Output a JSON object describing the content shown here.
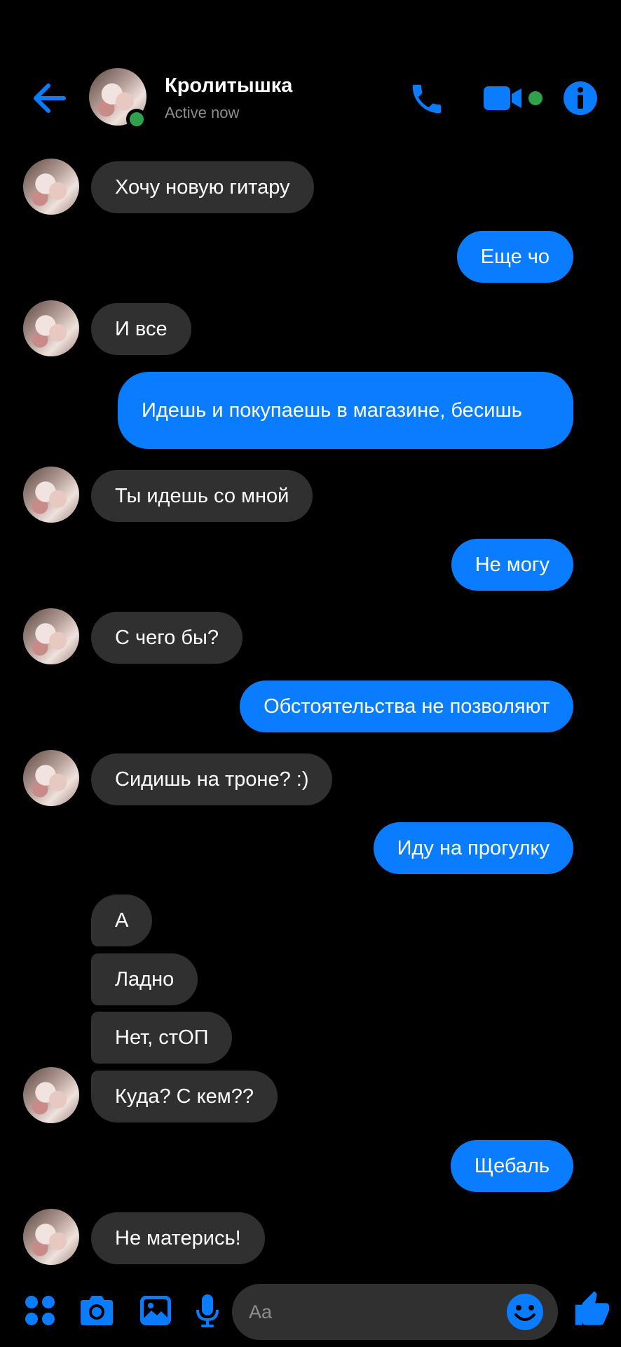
{
  "header": {
    "contact_name": "Кролитышка",
    "status": "Active now"
  },
  "colors": {
    "accent": "#0a7cff",
    "incoming_bubble": "#303030",
    "online": "#31a24c",
    "background": "#000000"
  },
  "icons": {
    "back": "arrow-left-icon",
    "call": "phone-icon",
    "video": "video-camera-icon",
    "info": "info-icon",
    "menu": "four-dots-icon",
    "camera": "camera-icon",
    "gallery": "image-icon",
    "mic": "microphone-icon",
    "emoji": "smiley-icon",
    "like": "thumbs-up-icon"
  },
  "messages": [
    {
      "from": "them",
      "text": "Хочу новую гитару"
    },
    {
      "from": "me",
      "text": "Еще чо"
    },
    {
      "from": "them",
      "text": "И все"
    },
    {
      "from": "me",
      "text": "Идешь и покупаешь в магазине, бесишь"
    },
    {
      "from": "them",
      "text": "Ты идешь со мной"
    },
    {
      "from": "me",
      "text": "Не могу"
    },
    {
      "from": "them",
      "text": "С чего бы?"
    },
    {
      "from": "me",
      "text": "Обстоятельства не позволяют"
    },
    {
      "from": "them",
      "text": "Сидишь на троне? :)"
    },
    {
      "from": "me",
      "text": "Иду на прогулку"
    },
    {
      "from": "them",
      "text": "А"
    },
    {
      "from": "them",
      "text": "Ладно"
    },
    {
      "from": "them",
      "text": "Нет, стОП"
    },
    {
      "from": "them",
      "text": "Куда? С кем??"
    },
    {
      "from": "me",
      "text": "Щебаль"
    },
    {
      "from": "them",
      "text": "Не матерись!"
    }
  ],
  "composer": {
    "placeholder": "Aa",
    "value": ""
  }
}
